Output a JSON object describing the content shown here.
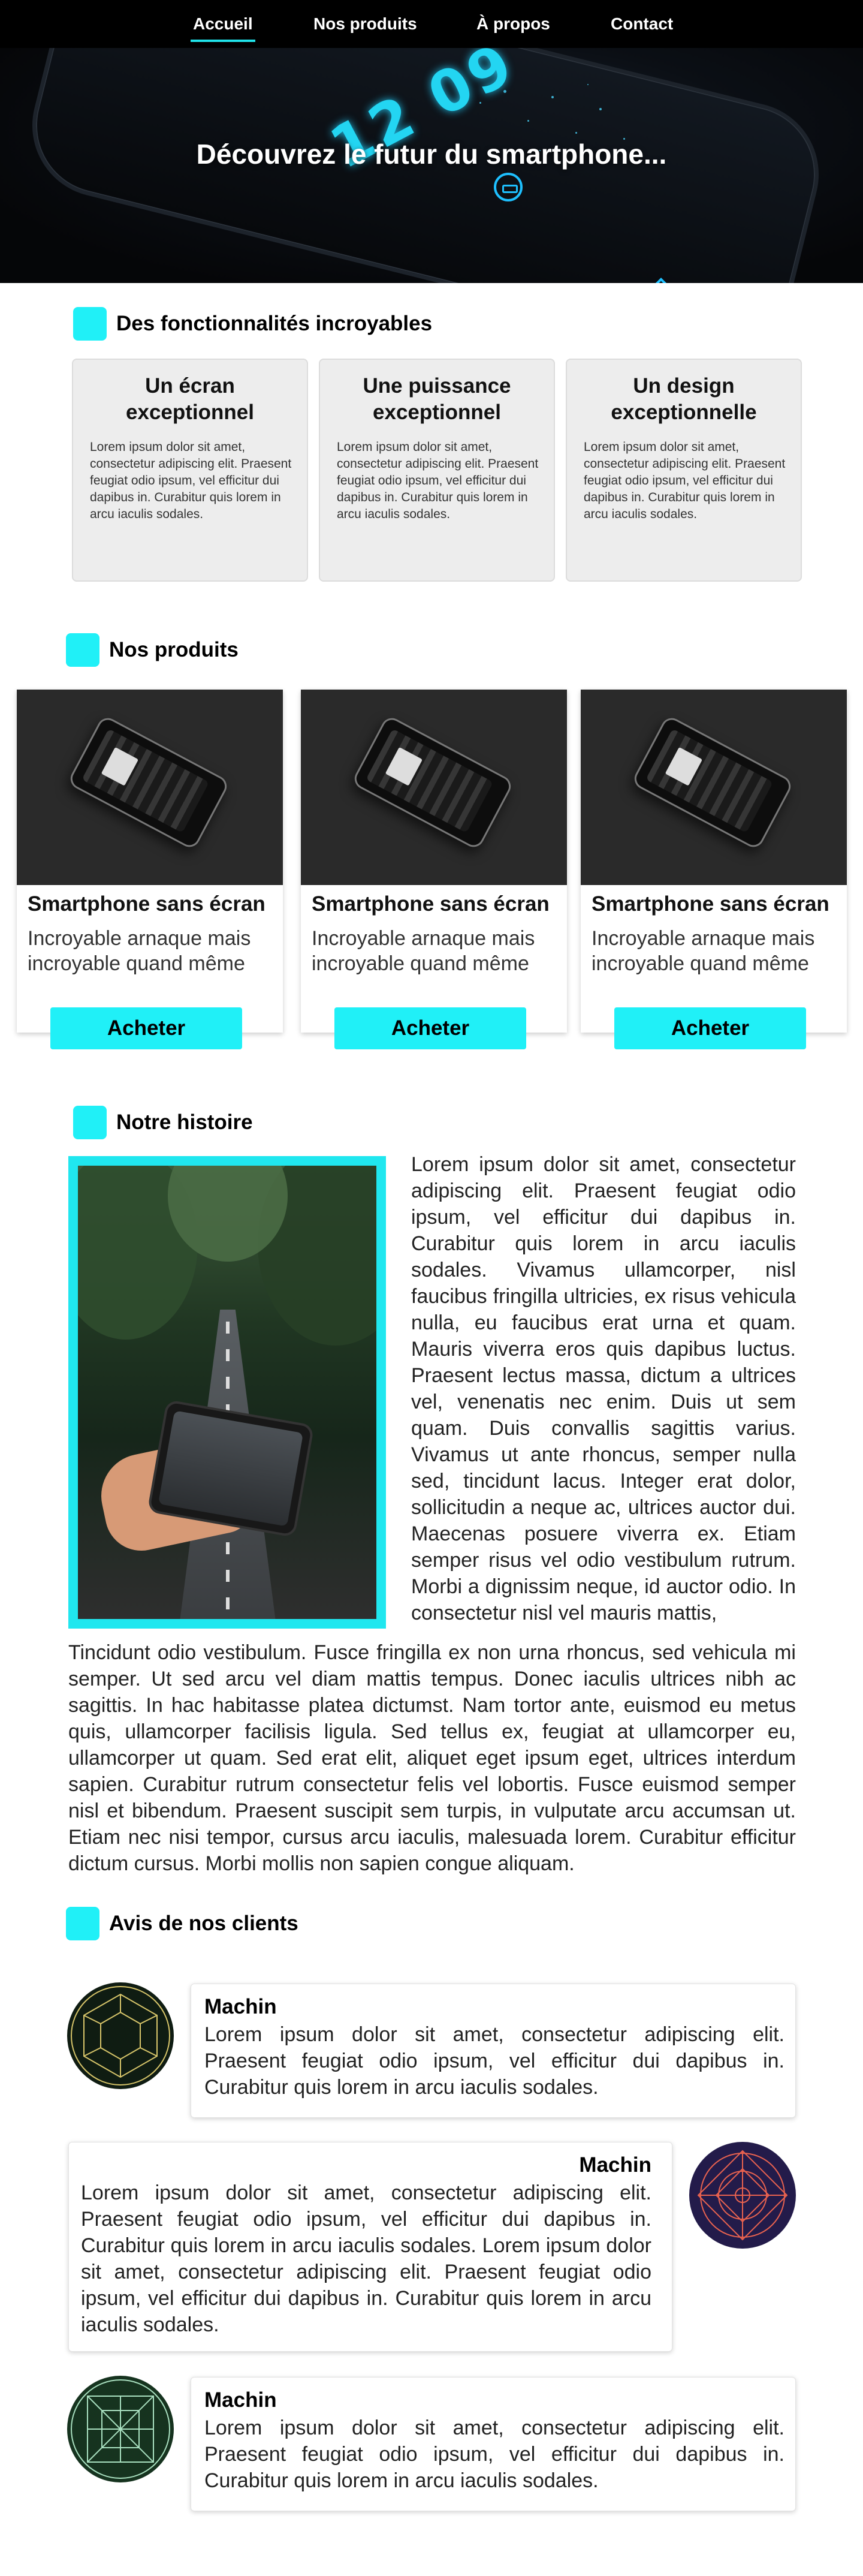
{
  "nav": {
    "items": [
      {
        "label": "Accueil",
        "active": true
      },
      {
        "label": "Nos produits",
        "active": false
      },
      {
        "label": "À propos",
        "active": false
      },
      {
        "label": "Contact",
        "active": false
      }
    ]
  },
  "hero": {
    "title": "Découvrez le futur du smartphone...",
    "clock": "12 09"
  },
  "features": {
    "heading": "Des fonctionnalités incroyables",
    "items": [
      {
        "title": "Un écran exceptionnel",
        "body": "Lorem ipsum dolor sit amet, consectetur adipiscing elit. Praesent feugiat odio ipsum, vel efficitur dui dapibus in. Curabitur quis lorem in arcu iaculis sodales."
      },
      {
        "title": "Une puissance exceptionnel",
        "body": "Lorem ipsum dolor sit amet, consectetur adipiscing elit. Praesent feugiat odio ipsum, vel efficitur dui dapibus in. Curabitur quis lorem in arcu iaculis sodales."
      },
      {
        "title": "Un design exceptionnelle",
        "body": "Lorem ipsum dolor sit amet, consectetur adipiscing elit. Praesent feugiat odio ipsum, vel efficitur dui dapibus in. Curabitur quis lorem in arcu iaculis sodales."
      }
    ]
  },
  "products": {
    "heading": "Nos produits",
    "items": [
      {
        "name": "Smartphone sans écran",
        "description": "Incroyable arnaque mais incroyable quand même",
        "button": "Acheter"
      },
      {
        "name": "Smartphone sans écran",
        "description": "Incroyable arnaque mais incroyable quand même",
        "button": "Acheter"
      },
      {
        "name": "Smartphone sans écran",
        "description": "Incroyable arnaque mais incroyable quand même",
        "button": "Acheter"
      }
    ]
  },
  "story": {
    "heading": "Notre histoire",
    "text_part1": "Lorem ipsum dolor sit amet, consectetur adipiscing elit. Praesent feugiat odio ipsum, vel efficitur dui dapibus in. Curabitur quis lorem in arcu iaculis sodales. Vivamus ullamcorper, nisl faucibus fringilla ultricies, ex risus vehicula nulla, eu faucibus erat urna et quam. Mauris viverra eros quis dapibus luctus. Praesent lectus massa, dictum a ultrices vel, venenatis nec enim. Duis ut sem quam. Duis convallis sagittis varius. Vivamus ut ante rhoncus, semper nulla sed, tincidunt lacus. Integer erat dolor, sollicitudin a neque ac, ultrices auctor dui. Maecenas posuere viverra ex. Etiam semper risus vel odio vestibulum rutrum. Morbi a dignissim neque, id auctor odio. In consectetur nisl vel mauris mattis,",
    "text_part2": "Tincidunt odio vestibulum. Fusce fringilla ex non urna rhoncus, sed vehicula mi semper. Ut sed arcu vel diam mattis tempus. Donec iaculis ultrices nibh ac sagittis. In hac habitasse platea dictumst. Nam tortor ante, euismod eu metus quis, ullamcorper facilisis ligula. Sed tellus ex, feugiat at ullamcorper eu, ullamcorper ut quam. Sed erat elit, aliquet eget ipsum eget, ultrices interdum sapien. Curabitur rutrum consectetur felis vel lobortis. Fusce euismod semper nisl et bibendum. Praesent suscipit sem turpis, in vulputate arcu accumsan ut. Etiam nec nisi tempor, cursus arcu iaculis, malesuada lorem. Curabitur efficitur dictum cursus. Morbi mollis non sapien congue aliquam."
  },
  "reviews": {
    "heading": "Avis de nos clients",
    "items": [
      {
        "name": "Machin",
        "text": "Lorem ipsum dolor sit amet, consectetur adipiscing elit. Praesent feugiat odio ipsum, vel efficitur dui dapibus in. Curabitur quis lorem in arcu iaculis sodales."
      },
      {
        "name": "Machin",
        "text": "Lorem ipsum dolor sit amet, consectetur adipiscing elit. Praesent feugiat odio ipsum, vel efficitur dui dapibus in. Curabitur quis lorem in arcu iaculis sodales. Lorem ipsum dolor sit amet, consectetur adipiscing elit. Praesent feugiat odio ipsum, vel efficitur dui dapibus in. Curabitur quis lorem in arcu iaculis sodales."
      },
      {
        "name": "Machin",
        "text": "Lorem ipsum dolor sit amet, consectetur adipiscing elit. Praesent feugiat odio ipsum, vel efficitur dui dapibus in. Curabitur quis lorem in arcu iaculis sodales."
      }
    ]
  },
  "colors": {
    "accent": "#20f0f7",
    "nav_bg": "#000000",
    "card_bg": "#ededed"
  },
  "icons": [
    "hexagon-pattern-avatar",
    "geometric-circle-avatar",
    "square-pattern-avatar"
  ]
}
